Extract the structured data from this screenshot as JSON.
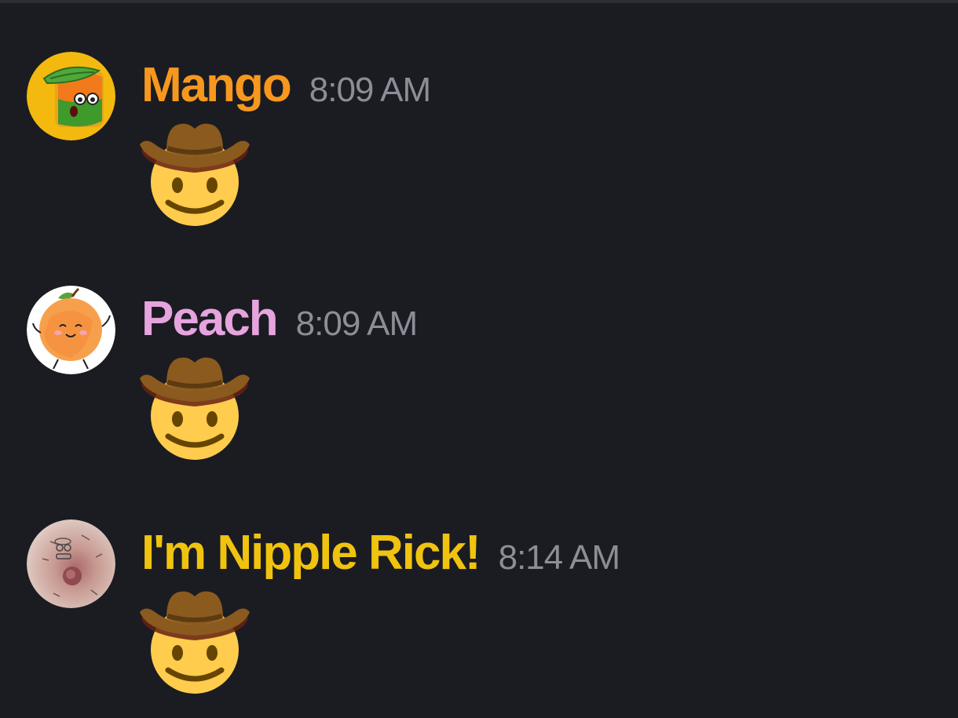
{
  "messages": [
    {
      "username": "Mango",
      "username_color": "#f7981e",
      "timestamp": "8:09 AM",
      "avatar_icon": "mango-character-avatar",
      "content_emoji": "cowboy-hat-face-emoji"
    },
    {
      "username": "Peach",
      "username_color": "#e6a4de",
      "timestamp": "8:09 AM",
      "avatar_icon": "peach-character-avatar",
      "content_emoji": "cowboy-hat-face-emoji"
    },
    {
      "username": "I'm Nipple Rick!",
      "username_color": "#f0c30f",
      "timestamp": "8:14 AM",
      "avatar_icon": "photo-avatar",
      "content_emoji": "cowboy-hat-face-emoji"
    }
  ],
  "colors": {
    "background": "#1b1c22",
    "timestamp": "#8b8e96"
  }
}
